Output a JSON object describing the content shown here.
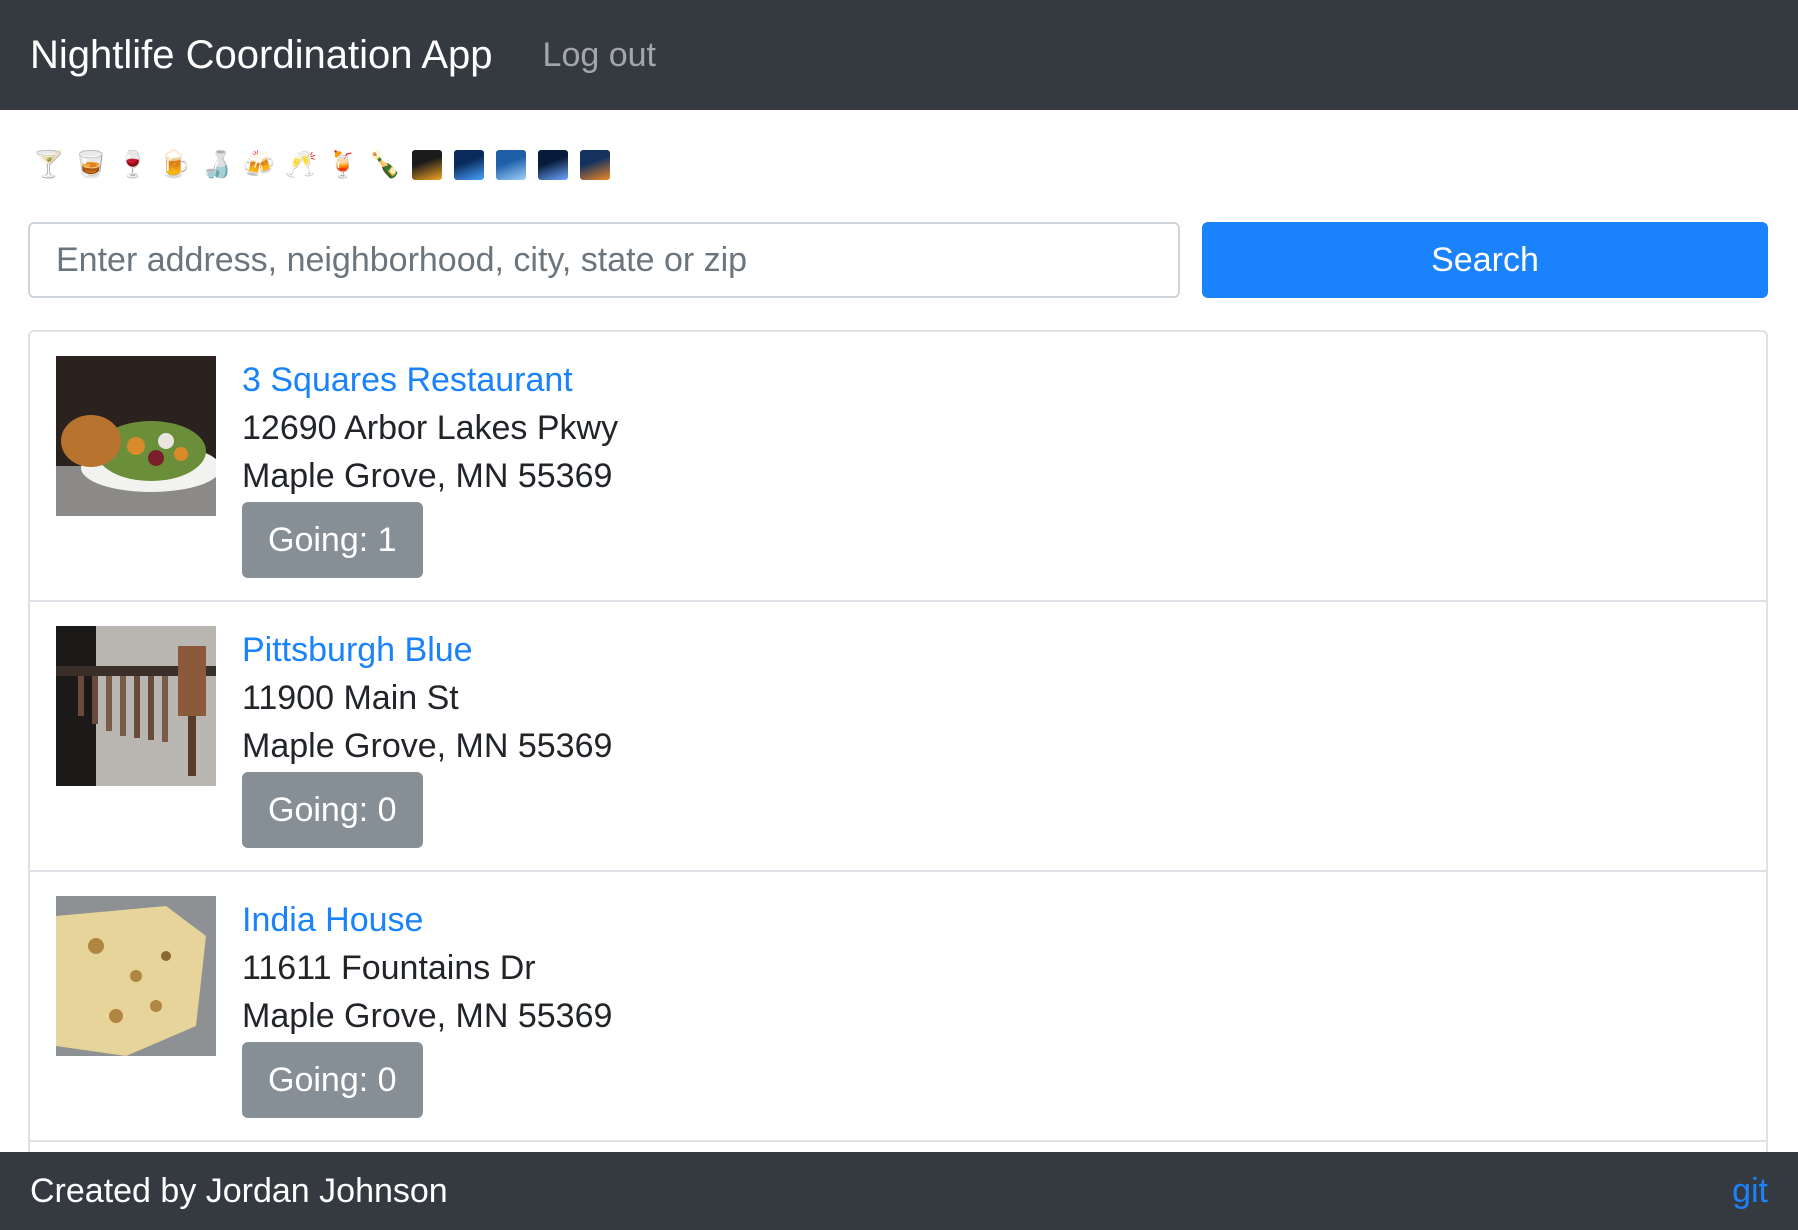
{
  "navbar": {
    "brand": "Nightlife Coordination App",
    "logout_label": "Log out"
  },
  "emojis": [
    {
      "glyph": "🍸",
      "icon": "cocktail-icon"
    },
    {
      "glyph": "🥃",
      "icon": "tumbler-glass-icon"
    },
    {
      "glyph": "🍷",
      "icon": "wine-glass-icon"
    },
    {
      "glyph": "🍺",
      "icon": "beer-mug-icon"
    },
    {
      "glyph": "🍶",
      "icon": "sake-icon"
    },
    {
      "glyph": "🍻",
      "icon": "clinking-beers-icon"
    },
    {
      "glyph": "🥂",
      "icon": "clinking-glasses-icon"
    },
    {
      "glyph": "🍹",
      "icon": "tropical-drink-icon"
    },
    {
      "glyph": "🍾",
      "icon": "champagne-bottle-icon"
    },
    {
      "glyph": "",
      "icon": "fireworks-icon",
      "colors": [
        "#1b1b1b",
        "#f5a623"
      ]
    },
    {
      "glyph": "",
      "icon": "city-night-icon",
      "colors": [
        "#0a2a5c",
        "#4aa3ff"
      ]
    },
    {
      "glyph": "",
      "icon": "cityscape-icon",
      "colors": [
        "#1e5fa8",
        "#9fd0ff"
      ]
    },
    {
      "glyph": "",
      "icon": "milky-way-icon",
      "colors": [
        "#071a3a",
        "#6fa8ff"
      ]
    },
    {
      "glyph": "",
      "icon": "bridge-at-night-icon",
      "colors": [
        "#14325e",
        "#f08a24"
      ]
    }
  ],
  "search": {
    "placeholder": "Enter address, neighborhood, city, state or zip",
    "value": "",
    "button_label": "Search"
  },
  "venues": [
    {
      "name": "3 Squares Restaurant",
      "address1": "12690 Arbor Lakes Pkwy",
      "address2": "Maple Grove, MN 55369",
      "going_label": "Going: 1",
      "thumb": "salad-photo"
    },
    {
      "name": "Pittsburgh Blue",
      "address1": "11900 Main St",
      "address2": "Maple Grove, MN 55369",
      "going_label": "Going: 0",
      "thumb": "knives-photo"
    },
    {
      "name": "India House",
      "address1": "11611 Fountains Dr",
      "address2": "Maple Grove, MN 55369",
      "going_label": "Going: 0",
      "thumb": "naan-photo"
    }
  ],
  "footer": {
    "credit": "Created by Jordan Johnson",
    "git_label": "git"
  },
  "colors": {
    "navbar": "#343a40",
    "primary": "#1a82fb",
    "secondary": "#868e96"
  }
}
